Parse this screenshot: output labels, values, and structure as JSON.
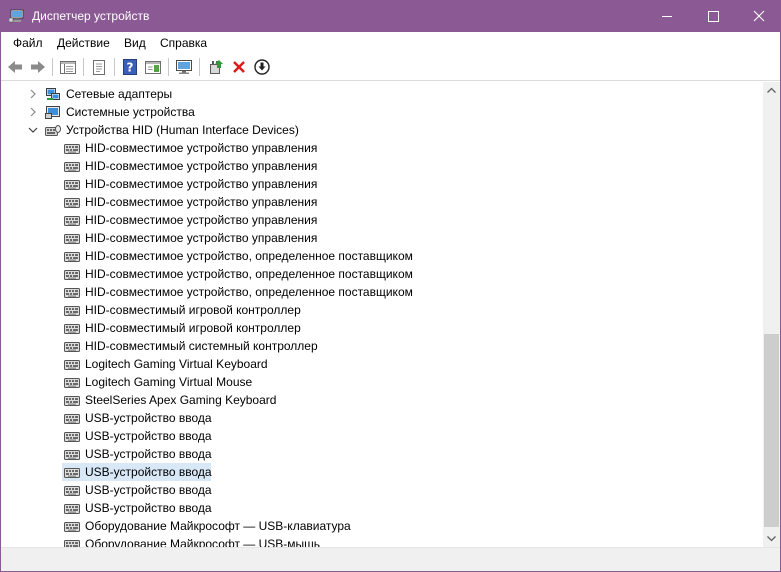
{
  "window": {
    "title": "Диспетчер устройств",
    "titlebar_color": "#8b5a94"
  },
  "menu": {
    "items": [
      "Файл",
      "Действие",
      "Вид",
      "Справка"
    ]
  },
  "toolbar": {
    "buttons": [
      "back-icon",
      "forward-icon",
      "properties-view-icon",
      "document-icon",
      "help-icon",
      "details-pane-icon",
      "monitor-icon",
      "update-driver-icon",
      "uninstall-icon",
      "download-icon"
    ]
  },
  "tree": {
    "categories": [
      {
        "label": "Сетевые адаптеры",
        "expanded": false,
        "icon": "network-adapter-icon"
      },
      {
        "label": "Системные устройства",
        "expanded": false,
        "icon": "system-device-icon"
      },
      {
        "label": "Устройства HID (Human Interface Devices)",
        "expanded": true,
        "icon": "hid-device-icon"
      }
    ],
    "hid_devices": [
      "HID-совместимое устройство управления",
      "HID-совместимое устройство управления",
      "HID-совместимое устройство управления",
      "HID-совместимое устройство управления",
      "HID-совместимое устройство управления",
      "HID-совместимое устройство управления",
      "HID-совместимое устройство, определенное поставщиком",
      "HID-совместимое устройство, определенное поставщиком",
      "HID-совместимое устройство, определенное поставщиком",
      "HID-совместимый игровой контроллер",
      "HID-совместимый игровой контроллер",
      "HID-совместимый системный контроллер",
      "Logitech Gaming Virtual Keyboard",
      "Logitech Gaming Virtual Mouse",
      "SteelSeries Apex Gaming Keyboard",
      "USB-устройство ввода",
      "USB-устройство ввода",
      "USB-устройство ввода",
      "USB-устройство ввода",
      "USB-устройство ввода",
      "USB-устройство ввода",
      "Оборудование Майкрософт — USB-клавиатура",
      "Оборудование Майкрософт — USB-мышь"
    ],
    "selected_device_index": 18,
    "selection_color": "#d9e8f7"
  }
}
